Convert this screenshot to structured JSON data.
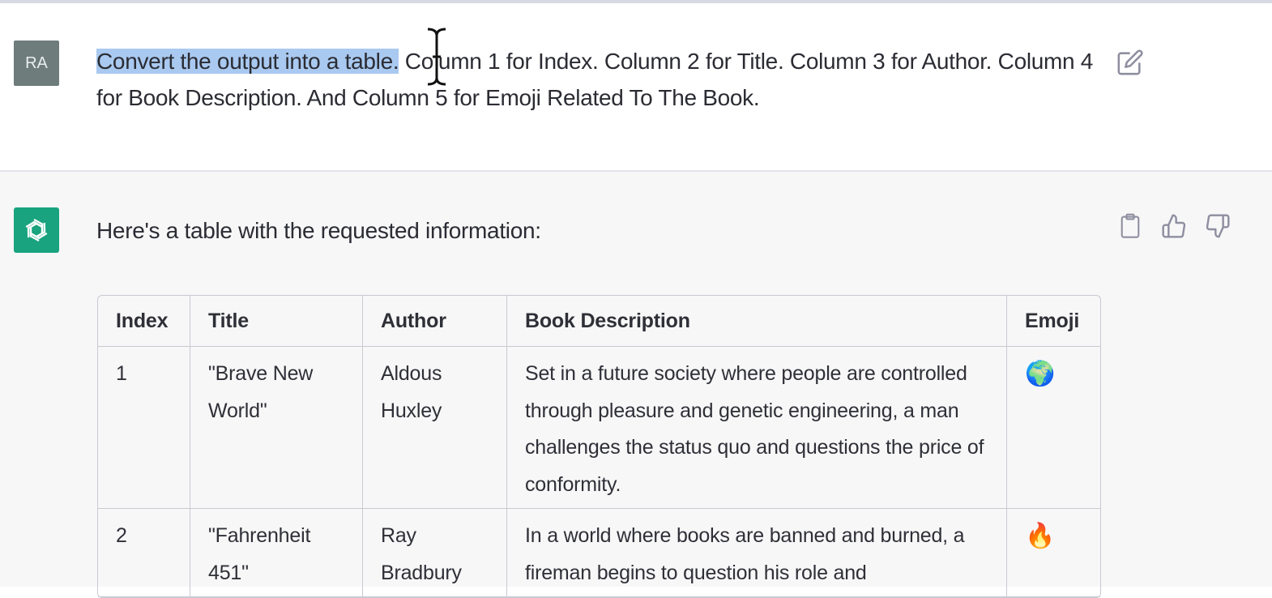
{
  "user_message": {
    "avatar_initials": "RA",
    "text_selected": "Convert the output into a table.",
    "text_rest": " Column 1 for Index. Column 2 for Title. Column 3 for Author. Column 4 for Book Description. And Column 5 for Emoji Related To The Book.",
    "edit_icon": "edit-icon"
  },
  "assistant_message": {
    "avatar_icon": "openai-logo-icon",
    "intro": "Here's a table with the requested information:",
    "actions": [
      "copy-icon",
      "thumbs-up-icon",
      "thumbs-down-icon"
    ]
  },
  "table": {
    "headers": [
      "Index",
      "Title",
      "Author",
      "Book Description",
      "Emoji"
    ],
    "rows": [
      [
        "1",
        "\"Brave New World\"",
        "Aldous Huxley",
        "Set in a future society where people are controlled through pleasure and genetic engineering, a man challenges the status quo and questions the price of conformity.",
        "🌍"
      ],
      [
        "2",
        "\"Fahrenheit 451\"",
        "Ray Bradbury",
        "In a world where books are banned and burned, a fireman begins to question his role and",
        "🔥"
      ]
    ]
  },
  "colors": {
    "selection": "#a9c9f0",
    "user_avatar": "#6e7c7b",
    "assistant_avatar": "#19a37f",
    "assistant_bg": "#f7f7f8"
  }
}
